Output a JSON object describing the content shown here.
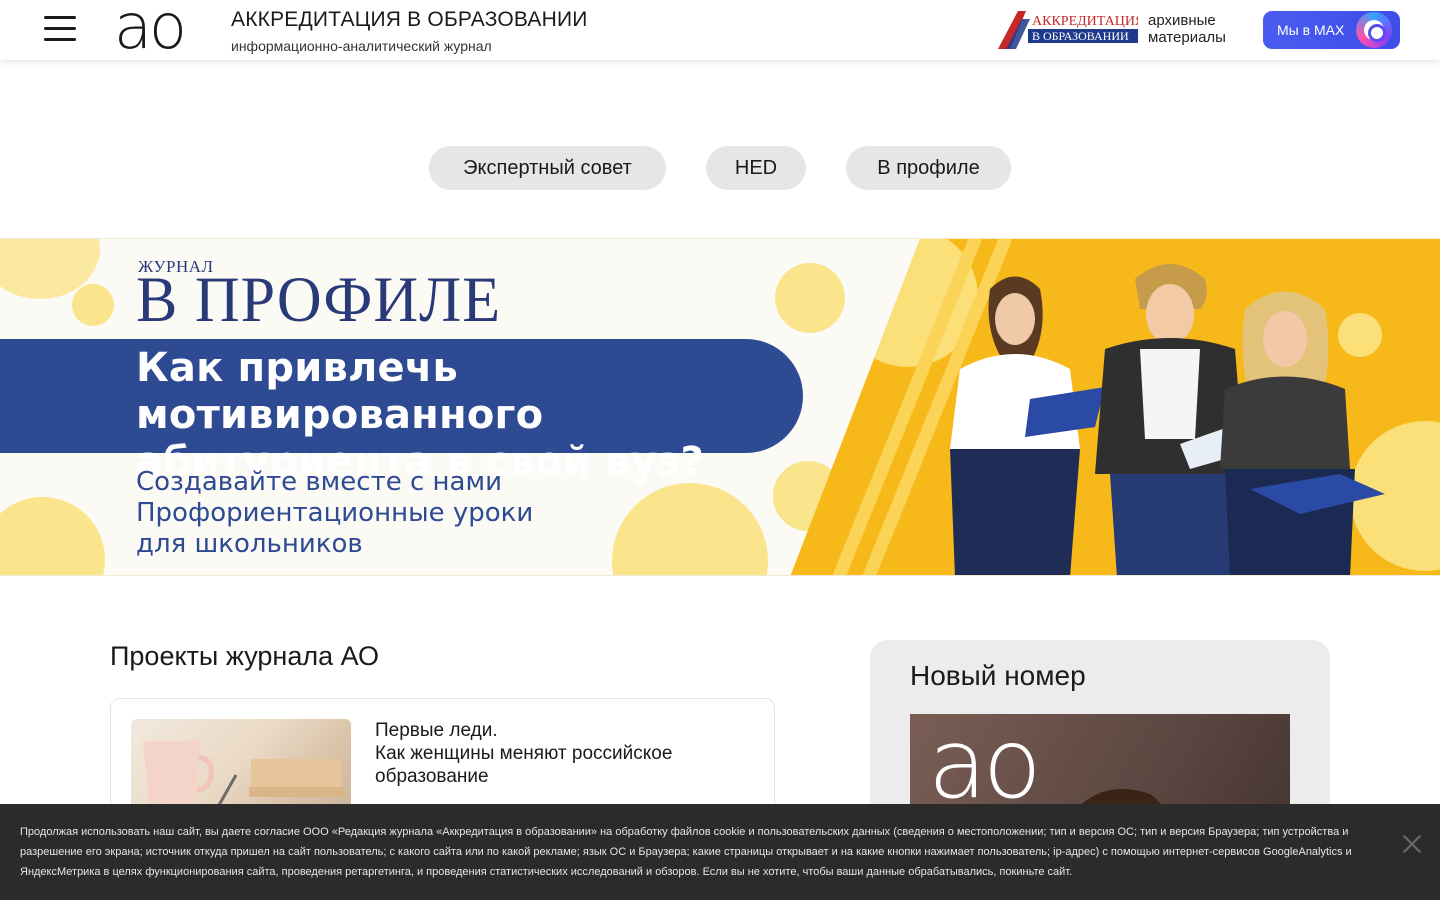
{
  "header": {
    "logo_text": "ао",
    "title": "АККРЕДИТАЦИЯ В ОБРАЗОВАНИИ",
    "subtitle": "информационно-аналитический журнал",
    "archive_logo_line1": "АККРЕДИТАЦИЯ",
    "archive_logo_line2": "В ОБРАЗОВАНИИ",
    "archive_text_line1": "архивные",
    "archive_text_line2": "материалы",
    "max_button_label": "Мы в MAX"
  },
  "pills": [
    {
      "label": "Экспертный совет"
    },
    {
      "label": "HED"
    },
    {
      "label": "В профиле"
    }
  ],
  "banner": {
    "journal_small": "ЖУРНАЛ",
    "journal_big": "В ПРОФИЛЕ",
    "headline_line1": "Как привлечь мотивированного",
    "headline_line2": "абитуриента в свой вуз?",
    "subline_line1": "Создавайте вместе с нами",
    "subline_line2": "Профориентационные уроки",
    "subline_line3": "для школьников"
  },
  "projects": {
    "section_title": "Проекты журнала АО",
    "items": [
      {
        "title_line1": "Первые леди.",
        "title_line2": "Как женщины меняют российское образование"
      }
    ]
  },
  "aside": {
    "title": "Новый номер",
    "cover_logo": "ао"
  },
  "cookie": {
    "text": "Продолжая использовать наш сайт, вы даете согласие ООО «Редакция журнала «Аккредитация в образовании» на обработку файлов cookie и пользовательских данных (сведения о местоположении; тип и версия ОС; тип и версия Браузера; тип устройства и разрешение его экрана; источник откуда пришел на сайт пользователь; с какого сайта или по какой рекламе; язык ОС и Браузера; какие страницы открывает и на какие кнопки нажимает пользователь; ip-адрес) с помощью интернет-сервисов GoogleAnalytics и ЯндексМетрика в целях функционирования сайта, проведения ретаргетинга, и проведения статистических исследований и обзоров. Если вы не хотите, чтобы ваши данные обрабатывались, покиньте сайт."
  },
  "colors": {
    "brand_blue": "#2e4a93",
    "banner_yellow": "#f6b919",
    "max_button": "#4a5cf0",
    "cookie_bg": "#2b2b2b"
  }
}
